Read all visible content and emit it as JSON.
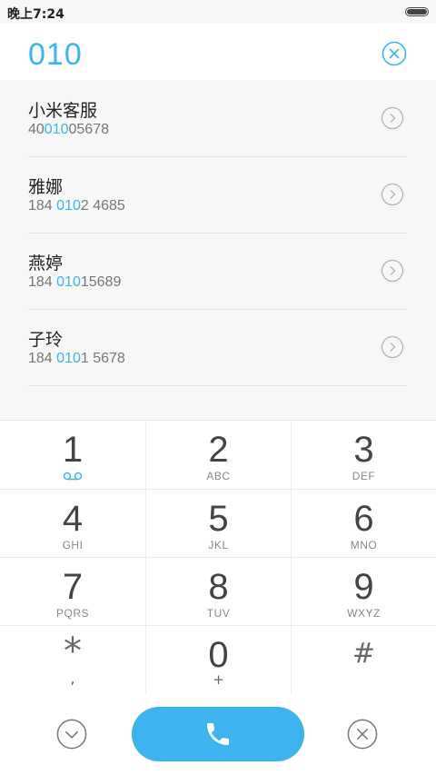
{
  "status_bar": {
    "time": "晚上7:24"
  },
  "dialer": {
    "input_value": "010"
  },
  "results": [
    {
      "name": "小米客服",
      "number_pre": "40",
      "number_match": "010",
      "number_post": "05678"
    },
    {
      "name": "雅娜",
      "number_pre": "184 ",
      "number_match": "010",
      "number_post": "2 4685"
    },
    {
      "name": "燕婷",
      "number_pre": "184 ",
      "number_match": "010",
      "number_post": "15689"
    },
    {
      "name": "子玲",
      "number_pre": "184 ",
      "number_match": "010",
      "number_post": "1 5678"
    }
  ],
  "keypad": {
    "k1": {
      "digit": "1",
      "letters": ""
    },
    "k2": {
      "digit": "2",
      "letters": "ABC"
    },
    "k3": {
      "digit": "3",
      "letters": "DEF"
    },
    "k4": {
      "digit": "4",
      "letters": "GHI"
    },
    "k5": {
      "digit": "5",
      "letters": "JKL"
    },
    "k6": {
      "digit": "6",
      "letters": "MNO"
    },
    "k7": {
      "digit": "7",
      "letters": "PQRS"
    },
    "k8": {
      "digit": "8",
      "letters": "TUV"
    },
    "k9": {
      "digit": "9",
      "letters": "WXYZ"
    },
    "kstar": {
      "digit": "*",
      "letters": ","
    },
    "k0": {
      "digit": "0",
      "letters": "+"
    },
    "khash": {
      "digit": "#",
      "letters": ""
    }
  },
  "icons": {
    "clear": "circle-x-icon",
    "row_arrow": "chevron-right-circle-icon",
    "voicemail": "voicemail-icon",
    "collapse": "chevron-down-circle-icon",
    "call": "phone-icon",
    "delete": "circle-x-icon"
  },
  "colors": {
    "accent": "#3db4ee",
    "results_bg": "#f7f7f7"
  }
}
